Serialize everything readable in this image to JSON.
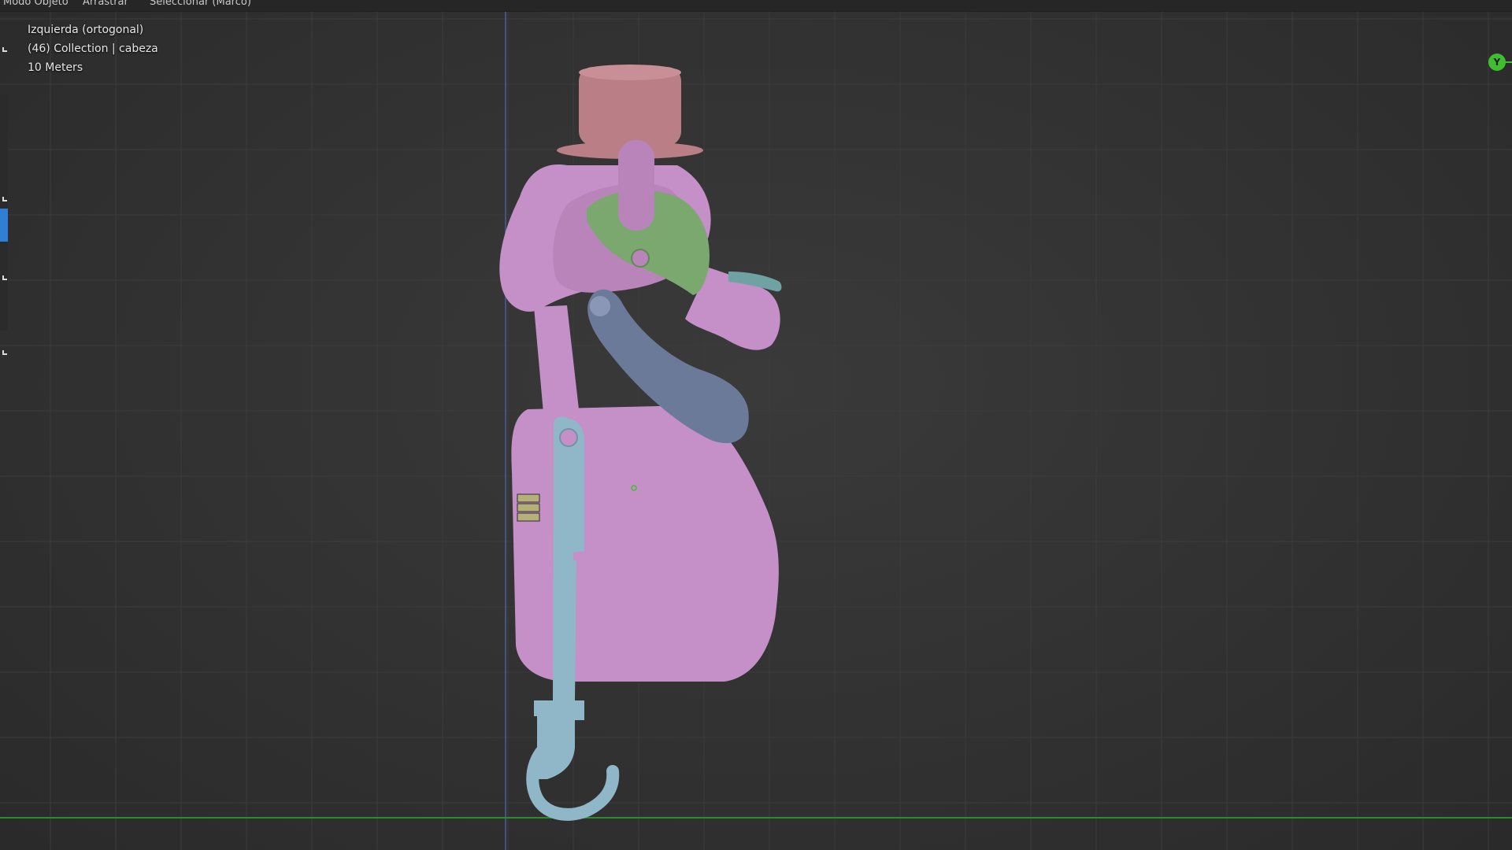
{
  "header": {
    "menu_items": [
      "Modo Objeto",
      "Arrastrar",
      "Seleccionar (Marco)"
    ]
  },
  "viewport": {
    "view_name": "Izquierda (ortogonal)",
    "collection_info": "(46) Collection | cabeza",
    "scale_info": "10 Meters"
  },
  "gizmo": {
    "y_axis_label": "Y"
  },
  "colors": {
    "grid_line": "#3c3c3c",
    "y_axis_line": "#4a5fa0",
    "ground_line": "#2f8a2f",
    "body_pink": "#c58fc8",
    "hat": "#b97e86",
    "helmet_green": "#7aa86f",
    "arm_blue_gray": "#6c7a99",
    "lever_light_blue": "#8fb7c7",
    "brow_teal": "#6fa3a3",
    "accent_yellow": "#b5b07a"
  },
  "icons": {
    "toolbar": [
      "select-tool-icon",
      "cursor-tool-icon",
      "move-tool-icon",
      "rotate-tool-icon"
    ]
  }
}
